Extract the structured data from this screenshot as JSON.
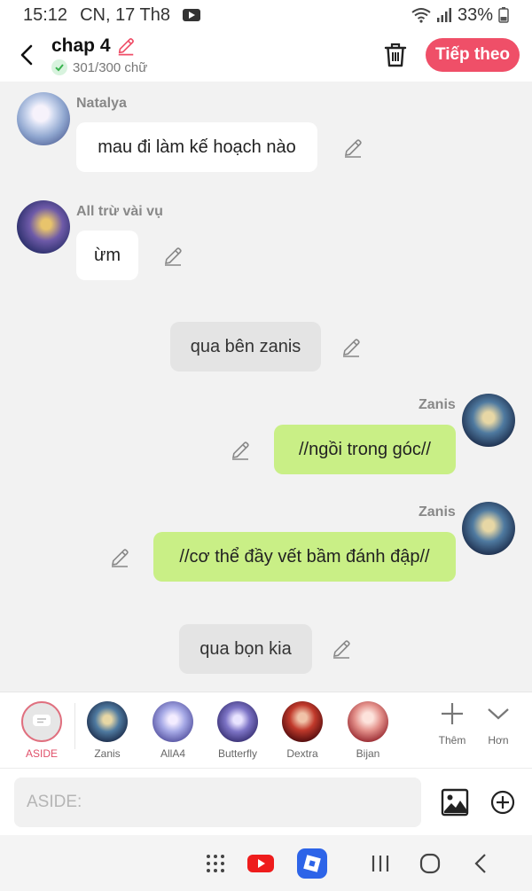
{
  "status_bar": {
    "time": "15:12",
    "date": "CN, 17 Th8",
    "battery": "33%"
  },
  "header": {
    "title": "chap 4",
    "word_count": "301/300 chữ",
    "next_label": "Tiếp theo"
  },
  "messages": [
    {
      "sender": "Natalya",
      "text": "mau đi làm kế hoạch nào"
    },
    {
      "sender": "All trừ vài vụ",
      "text": "ừm"
    },
    {
      "sender": "",
      "text": "qua bên zanis"
    },
    {
      "sender": "Zanis",
      "text": "//ngồi trong góc//"
    },
    {
      "sender": "Zanis",
      "text": "//cơ thể đầy vết bầm đánh đập//"
    },
    {
      "sender": "",
      "text": "qua bọn kia"
    }
  ],
  "characters": [
    {
      "name": "ASIDE",
      "color": "#e0506a"
    },
    {
      "name": "Zanis"
    },
    {
      "name": "AllA4"
    },
    {
      "name": "Butterfly"
    },
    {
      "name": "Dextra"
    },
    {
      "name": "Bijan"
    }
  ],
  "char_actions": {
    "add": "Thêm",
    "more": "Hơn"
  },
  "input": {
    "placeholder": "ASIDE:"
  },
  "colors": {
    "accent": "#ef4f68",
    "self_bubble": "#c9ef86",
    "aside_bubble": "#e4e4e4"
  },
  "icons": [
    "back-icon",
    "edit-title-icon",
    "check-icon",
    "trash-icon",
    "edit-icon",
    "plus-icon",
    "chevron-down-icon",
    "image-icon",
    "add-circle-icon"
  ]
}
